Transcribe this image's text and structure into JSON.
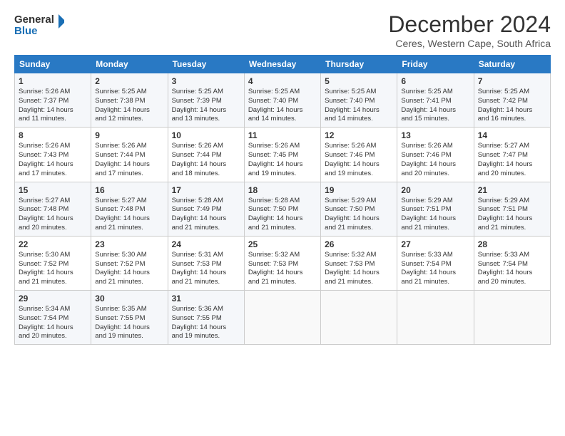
{
  "logo": {
    "line1": "General",
    "line2": "Blue"
  },
  "title": "December 2024",
  "subtitle": "Ceres, Western Cape, South Africa",
  "days_header": [
    "Sunday",
    "Monday",
    "Tuesday",
    "Wednesday",
    "Thursday",
    "Friday",
    "Saturday"
  ],
  "weeks": [
    [
      {
        "day": "1",
        "info": "Sunrise: 5:26 AM\nSunset: 7:37 PM\nDaylight: 14 hours\nand 11 minutes."
      },
      {
        "day": "2",
        "info": "Sunrise: 5:25 AM\nSunset: 7:38 PM\nDaylight: 14 hours\nand 12 minutes."
      },
      {
        "day": "3",
        "info": "Sunrise: 5:25 AM\nSunset: 7:39 PM\nDaylight: 14 hours\nand 13 minutes."
      },
      {
        "day": "4",
        "info": "Sunrise: 5:25 AM\nSunset: 7:40 PM\nDaylight: 14 hours\nand 14 minutes."
      },
      {
        "day": "5",
        "info": "Sunrise: 5:25 AM\nSunset: 7:40 PM\nDaylight: 14 hours\nand 14 minutes."
      },
      {
        "day": "6",
        "info": "Sunrise: 5:25 AM\nSunset: 7:41 PM\nDaylight: 14 hours\nand 15 minutes."
      },
      {
        "day": "7",
        "info": "Sunrise: 5:25 AM\nSunset: 7:42 PM\nDaylight: 14 hours\nand 16 minutes."
      }
    ],
    [
      {
        "day": "8",
        "info": "Sunrise: 5:26 AM\nSunset: 7:43 PM\nDaylight: 14 hours\nand 17 minutes."
      },
      {
        "day": "9",
        "info": "Sunrise: 5:26 AM\nSunset: 7:44 PM\nDaylight: 14 hours\nand 17 minutes."
      },
      {
        "day": "10",
        "info": "Sunrise: 5:26 AM\nSunset: 7:44 PM\nDaylight: 14 hours\nand 18 minutes."
      },
      {
        "day": "11",
        "info": "Sunrise: 5:26 AM\nSunset: 7:45 PM\nDaylight: 14 hours\nand 19 minutes."
      },
      {
        "day": "12",
        "info": "Sunrise: 5:26 AM\nSunset: 7:46 PM\nDaylight: 14 hours\nand 19 minutes."
      },
      {
        "day": "13",
        "info": "Sunrise: 5:26 AM\nSunset: 7:46 PM\nDaylight: 14 hours\nand 20 minutes."
      },
      {
        "day": "14",
        "info": "Sunrise: 5:27 AM\nSunset: 7:47 PM\nDaylight: 14 hours\nand 20 minutes."
      }
    ],
    [
      {
        "day": "15",
        "info": "Sunrise: 5:27 AM\nSunset: 7:48 PM\nDaylight: 14 hours\nand 20 minutes."
      },
      {
        "day": "16",
        "info": "Sunrise: 5:27 AM\nSunset: 7:48 PM\nDaylight: 14 hours\nand 21 minutes."
      },
      {
        "day": "17",
        "info": "Sunrise: 5:28 AM\nSunset: 7:49 PM\nDaylight: 14 hours\nand 21 minutes."
      },
      {
        "day": "18",
        "info": "Sunrise: 5:28 AM\nSunset: 7:50 PM\nDaylight: 14 hours\nand 21 minutes."
      },
      {
        "day": "19",
        "info": "Sunrise: 5:29 AM\nSunset: 7:50 PM\nDaylight: 14 hours\nand 21 minutes."
      },
      {
        "day": "20",
        "info": "Sunrise: 5:29 AM\nSunset: 7:51 PM\nDaylight: 14 hours\nand 21 minutes."
      },
      {
        "day": "21",
        "info": "Sunrise: 5:29 AM\nSunset: 7:51 PM\nDaylight: 14 hours\nand 21 minutes."
      }
    ],
    [
      {
        "day": "22",
        "info": "Sunrise: 5:30 AM\nSunset: 7:52 PM\nDaylight: 14 hours\nand 21 minutes."
      },
      {
        "day": "23",
        "info": "Sunrise: 5:30 AM\nSunset: 7:52 PM\nDaylight: 14 hours\nand 21 minutes."
      },
      {
        "day": "24",
        "info": "Sunrise: 5:31 AM\nSunset: 7:53 PM\nDaylight: 14 hours\nand 21 minutes."
      },
      {
        "day": "25",
        "info": "Sunrise: 5:32 AM\nSunset: 7:53 PM\nDaylight: 14 hours\nand 21 minutes."
      },
      {
        "day": "26",
        "info": "Sunrise: 5:32 AM\nSunset: 7:53 PM\nDaylight: 14 hours\nand 21 minutes."
      },
      {
        "day": "27",
        "info": "Sunrise: 5:33 AM\nSunset: 7:54 PM\nDaylight: 14 hours\nand 21 minutes."
      },
      {
        "day": "28",
        "info": "Sunrise: 5:33 AM\nSunset: 7:54 PM\nDaylight: 14 hours\nand 20 minutes."
      }
    ],
    [
      {
        "day": "29",
        "info": "Sunrise: 5:34 AM\nSunset: 7:54 PM\nDaylight: 14 hours\nand 20 minutes."
      },
      {
        "day": "30",
        "info": "Sunrise: 5:35 AM\nSunset: 7:55 PM\nDaylight: 14 hours\nand 19 minutes."
      },
      {
        "day": "31",
        "info": "Sunrise: 5:36 AM\nSunset: 7:55 PM\nDaylight: 14 hours\nand 19 minutes."
      },
      {
        "day": "",
        "info": ""
      },
      {
        "day": "",
        "info": ""
      },
      {
        "day": "",
        "info": ""
      },
      {
        "day": "",
        "info": ""
      }
    ]
  ]
}
